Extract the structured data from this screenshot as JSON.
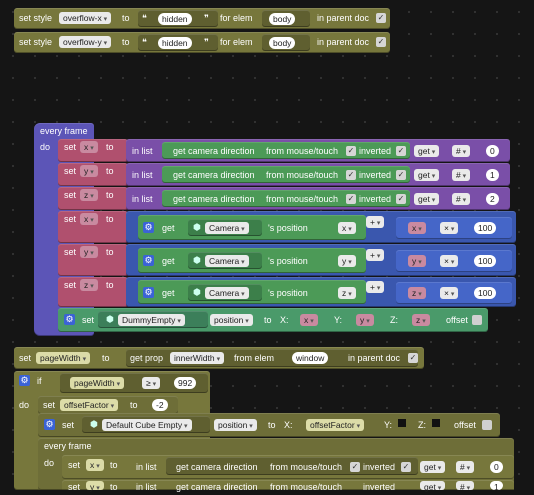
{
  "style_rows": [
    {
      "set_style": "set style",
      "prop": "overflow-x",
      "to": "to",
      "value": "hidden",
      "for_elem": "for elem",
      "elem": "body",
      "in_parent": "in parent doc"
    },
    {
      "set_style": "set style",
      "prop": "overflow-y",
      "to": "to",
      "value": "hidden",
      "for_elem": "for elem",
      "elem": "body",
      "in_parent": "in parent doc"
    }
  ],
  "every_frame": {
    "label": "every frame",
    "do": "do",
    "set": "set",
    "to": "to",
    "in_list": "in list",
    "get_cam_dir": "get camera direction",
    "from_mouse": "from mouse/touch",
    "inverted": "inverted",
    "get": "get",
    "hash": "#",
    "rows": [
      {
        "var": "x",
        "index": "0"
      },
      {
        "var": "y",
        "index": "1"
      },
      {
        "var": "z",
        "index": "2"
      }
    ],
    "pos_rows": [
      {
        "var": "x",
        "axis": "x",
        "mult_var": "x",
        "mult_op": "×",
        "op": "+",
        "num": "100"
      },
      {
        "var": "y",
        "axis": "y",
        "mult_var": "y",
        "mult_op": "×",
        "op": "+",
        "num": "100"
      },
      {
        "var": "z",
        "axis": "z",
        "mult_var": "z",
        "mult_op": "×",
        "op": "+",
        "num": "100"
      }
    ],
    "camera": "Camera",
    "s_position": "'s position",
    "dummy": {
      "set": "set",
      "obj": "DummyEmpty",
      "prop": "position",
      "to": "to",
      "x_lbl": "X:",
      "x": "x",
      "y_lbl": "Y:",
      "y": "y",
      "z_lbl": "Z:",
      "z": "z",
      "offset": "offset"
    }
  },
  "page_width": {
    "set": "set",
    "var": "pageWidth",
    "to": "to",
    "get_prop": "get prop",
    "prop": "innerWidth",
    "from_elem": "from elem",
    "elem": "window",
    "in_parent": "in parent doc"
  },
  "if_block": {
    "if": "if",
    "var": "pageWidth",
    "cmp": "≥",
    "num": "992",
    "do": "do",
    "set": "set",
    "offset_var": "offsetFactor",
    "to": "to",
    "offset_val": "-2",
    "cube": {
      "set": "set",
      "obj": "Default Cube Empty",
      "prop": "position",
      "to": "to",
      "x_lbl": "X:",
      "x": "offsetFactor",
      "y_lbl": "Y:",
      "z_lbl": "Z:",
      "offset": "offset"
    },
    "every_frame": "every frame",
    "inner_rows": [
      {
        "var": "x",
        "index": "0"
      },
      {
        "var": "y",
        "index": "1"
      }
    ]
  }
}
